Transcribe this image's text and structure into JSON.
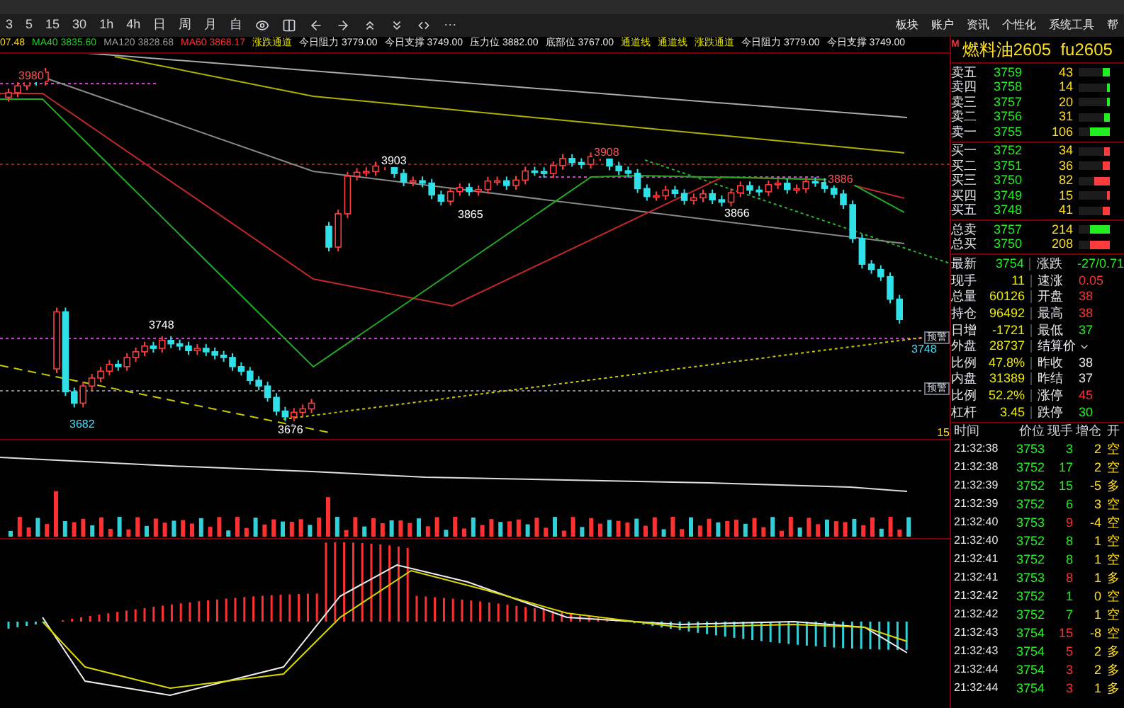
{
  "toolbar": {
    "periods": [
      {
        "label": "3",
        "selected": false
      },
      {
        "label": "5",
        "selected": false
      },
      {
        "label": "15",
        "selected": false
      },
      {
        "label": "30",
        "selected": false
      },
      {
        "label": "1h",
        "selected": false
      },
      {
        "label": "4h",
        "selected": false
      },
      {
        "label": "日",
        "selected": false
      },
      {
        "label": "周",
        "selected": false
      },
      {
        "label": "月",
        "selected": false
      },
      {
        "label": "自",
        "selected": false
      }
    ],
    "more": "···",
    "menu": [
      "板块",
      "账户",
      "资讯",
      "个性化",
      "系统工具",
      "帮"
    ]
  },
  "indicators": [
    {
      "text": "07.48",
      "kind": "price"
    },
    {
      "text": "MA40 3835.60",
      "kind": "ma40"
    },
    {
      "text": "MA120 3828.68",
      "kind": "ma120"
    },
    {
      "text": "MA60 3868.17",
      "kind": "ma60"
    },
    {
      "text": "涨跌通道",
      "kind": "channel"
    },
    {
      "text": "今日阻力 3779.00",
      "kind": "level"
    },
    {
      "text": "今日支撑 3749.00",
      "kind": "level"
    },
    {
      "text": "压力位 3882.00",
      "kind": "level"
    },
    {
      "text": "底部位 3767.00",
      "kind": "level"
    },
    {
      "text": "通道线",
      "kind": "channel"
    },
    {
      "text": "通道线",
      "kind": "channel"
    },
    {
      "text": "涨跌通道",
      "kind": "channel"
    },
    {
      "text": "今日阻力 3779.00",
      "kind": "level"
    },
    {
      "text": "今日支撑 3749.00",
      "kind": "level"
    }
  ],
  "chart": {
    "price_labels": [
      "3980",
      "3903",
      "3865",
      "3908",
      "3866",
      "3886",
      "3748",
      "3682",
      "3676",
      "3748"
    ],
    "alerts": [
      "预警",
      "预警"
    ],
    "period_tag": "15"
  },
  "quote": {
    "badge": "M",
    "title": "燃料油2605  fu2605",
    "asks": [
      {
        "label": "卖五",
        "price": "3759",
        "volume": "43",
        "level": 0.25
      },
      {
        "label": "卖四",
        "price": "3758",
        "volume": "14",
        "level": 0.08
      },
      {
        "label": "卖三",
        "price": "3757",
        "volume": "20",
        "level": 0.1
      },
      {
        "label": "卖二",
        "price": "3756",
        "volume": "31",
        "level": 0.2
      },
      {
        "label": "卖一",
        "price": "3755",
        "volume": "106",
        "level": 0.65
      }
    ],
    "bids": [
      {
        "label": "买一",
        "price": "3752",
        "volume": "34",
        "level": 0.2
      },
      {
        "label": "买二",
        "price": "3751",
        "volume": "36",
        "level": 0.22
      },
      {
        "label": "买三",
        "price": "3750",
        "volume": "82",
        "level": 0.5
      },
      {
        "label": "买四",
        "price": "3749",
        "volume": "15",
        "level": 0.07
      },
      {
        "label": "买五",
        "price": "3748",
        "volume": "41",
        "level": 0.25
      }
    ],
    "totals": [
      {
        "label": "总卖",
        "price": "3757",
        "volume": "214",
        "level": 0.65,
        "kind": "ask"
      },
      {
        "label": "总买",
        "price": "3750",
        "volume": "208",
        "level": 0.63,
        "kind": "bid"
      }
    ],
    "stats": [
      {
        "left": {
          "label": "最新",
          "value": "3754",
          "kind": "down"
        },
        "right": {
          "label": "涨跌",
          "value": "-27/0.71",
          "kind": "down"
        }
      },
      {
        "left": {
          "label": "现手",
          "value": "11",
          "kind": "flat"
        },
        "right": {
          "label": "速涨",
          "value": "0.05",
          "kind": "up"
        }
      },
      {
        "left": {
          "label": "总量",
          "value": "60126",
          "kind": "flat"
        },
        "right": {
          "label": "开盘",
          "value": "38",
          "kind": "up"
        }
      },
      {
        "left": {
          "label": "持仓",
          "value": "96492",
          "kind": "flat"
        },
        "right": {
          "label": "最高",
          "value": "38",
          "kind": "up"
        }
      },
      {
        "left": {
          "label": "日增",
          "value": "-1721",
          "kind": "flat"
        },
        "right": {
          "label": "最低",
          "value": "37",
          "kind": "down"
        }
      },
      {
        "left": {
          "label": "外盘",
          "value": "28737",
          "kind": "flat"
        },
        "right": {
          "label": "结算价",
          "kind": "dropdown"
        }
      },
      {
        "left": {
          "label": "比例",
          "value": "47.8%",
          "kind": "flat"
        },
        "right": {
          "label": "昨收",
          "value": "38",
          "kind": "plain"
        }
      },
      {
        "left": {
          "label": "内盘",
          "value": "31389",
          "kind": "flat"
        },
        "right": {
          "label": "昨结",
          "value": "37",
          "kind": "plain"
        }
      },
      {
        "left": {
          "label": "比例",
          "value": "52.2%",
          "kind": "flat"
        },
        "right": {
          "label": "涨停",
          "value": "45",
          "kind": "up"
        }
      },
      {
        "left": {
          "label": "杠杆",
          "value": "3.45",
          "kind": "flat"
        },
        "right": {
          "label": "跌停",
          "value": "30",
          "kind": "down"
        }
      }
    ]
  },
  "ticks": {
    "columns": [
      "时间",
      "价位",
      "现手",
      "增仓",
      "开"
    ],
    "rows": [
      {
        "time": "21:32:38",
        "price": "3753",
        "hand": "3",
        "kind": "down",
        "change": "2",
        "type": "空"
      },
      {
        "time": "21:32:38",
        "price": "3752",
        "hand": "17",
        "kind": "down",
        "change": "2",
        "type": "空"
      },
      {
        "time": "21:32:39",
        "price": "3752",
        "hand": "15",
        "kind": "down",
        "change": "-5",
        "type": "多"
      },
      {
        "time": "21:32:39",
        "price": "3752",
        "hand": "6",
        "kind": "down",
        "change": "3",
        "type": "空"
      },
      {
        "time": "21:32:40",
        "price": "3753",
        "hand": "9",
        "kind": "up",
        "change": "-4",
        "type": "空"
      },
      {
        "time": "21:32:40",
        "price": "3752",
        "hand": "8",
        "kind": "down",
        "change": "1",
        "type": "空"
      },
      {
        "time": "21:32:41",
        "price": "3752",
        "hand": "8",
        "kind": "down",
        "change": "1",
        "type": "空"
      },
      {
        "time": "21:32:41",
        "price": "3753",
        "hand": "8",
        "kind": "up",
        "change": "1",
        "type": "多"
      },
      {
        "time": "21:32:42",
        "price": "3752",
        "hand": "1",
        "kind": "down",
        "change": "0",
        "type": "空"
      },
      {
        "time": "21:32:42",
        "price": "3752",
        "hand": "7",
        "kind": "down",
        "change": "1",
        "type": "空"
      },
      {
        "time": "21:32:43",
        "price": "3754",
        "hand": "15",
        "kind": "up",
        "change": "-8",
        "type": "空"
      },
      {
        "time": "21:32:43",
        "price": "3754",
        "hand": "5",
        "kind": "up",
        "change": "2",
        "type": "多"
      },
      {
        "time": "21:32:44",
        "price": "3754",
        "hand": "3",
        "kind": "up",
        "change": "2",
        "type": "多"
      },
      {
        "time": "21:32:44",
        "price": "3754",
        "hand": "3",
        "kind": "up",
        "change": "1",
        "type": "多"
      }
    ]
  }
}
